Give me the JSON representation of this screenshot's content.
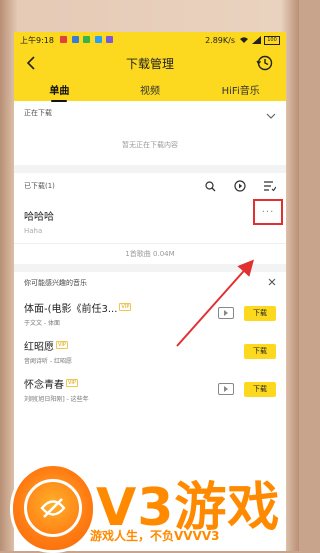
{
  "status_bar": {
    "time": "上午9:18",
    "speed": "2.89K/s",
    "battery": "100"
  },
  "header": {
    "title": "下载管理"
  },
  "tabs": [
    {
      "label": "单曲",
      "active": true
    },
    {
      "label": "视频",
      "active": false
    },
    {
      "label": "HiFi音乐",
      "active": false
    }
  ],
  "downloading": {
    "label": "正在下载",
    "empty_text": "暂无正在下载内容"
  },
  "downloaded": {
    "label": "已下载(1)",
    "songs": [
      {
        "title": "哈哈哈",
        "subtitle": "Haha",
        "more": "···"
      }
    ],
    "count_text": "1首歌曲 0.04M"
  },
  "recommend": {
    "label": "你可能感兴趣的音乐",
    "items": [
      {
        "title": "体面-(电影《前任3...",
        "sub": "于文文 - 体面",
        "button": "下载"
      },
      {
        "title": "红昭愿",
        "sub": "音阙诗听 - 红昭愿",
        "button": "下载"
      },
      {
        "title": "怀念青春",
        "sub": "刘刚[旭日阳刚] - 这些年",
        "button": "下载"
      }
    ]
  },
  "watermark": {
    "brand": "V3游戏",
    "slogan": "游戏人生，不负VVVV3"
  },
  "colors": {
    "accent": "#fcd91f",
    "arrow": "#e23030",
    "watermark": "#ff8a00"
  }
}
